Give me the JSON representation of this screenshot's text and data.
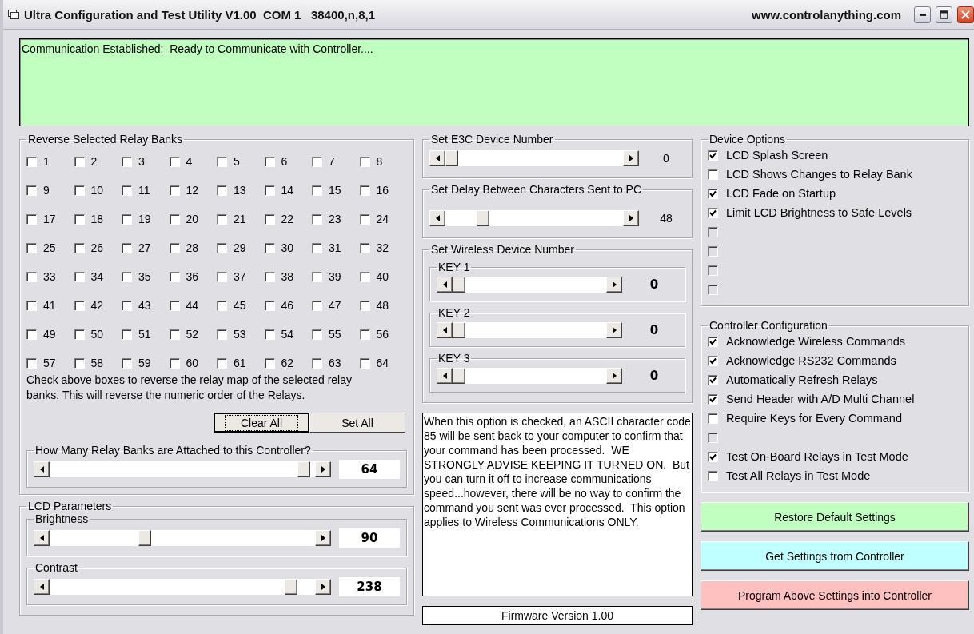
{
  "window": {
    "title": "Ultra Configuration and Test Utility V1.00  COM 1   38400,n,8,1",
    "website": "www.controlanything.com"
  },
  "status_message": "Communication Established:  Ready to Communicate with Controller....",
  "relay_banks": {
    "title": "Reverse Selected Relay Banks",
    "checkboxes": [
      {
        "label": "1",
        "checked": false
      },
      {
        "label": "2",
        "checked": false
      },
      {
        "label": "3",
        "checked": false
      },
      {
        "label": "4",
        "checked": false
      },
      {
        "label": "5",
        "checked": false
      },
      {
        "label": "6",
        "checked": false
      },
      {
        "label": "7",
        "checked": false
      },
      {
        "label": "8",
        "checked": false
      },
      {
        "label": "9",
        "checked": false
      },
      {
        "label": "10",
        "checked": false
      },
      {
        "label": "11",
        "checked": false
      },
      {
        "label": "12",
        "checked": false
      },
      {
        "label": "13",
        "checked": false
      },
      {
        "label": "14",
        "checked": false
      },
      {
        "label": "15",
        "checked": false
      },
      {
        "label": "16",
        "checked": false
      },
      {
        "label": "17",
        "checked": false
      },
      {
        "label": "18",
        "checked": false
      },
      {
        "label": "19",
        "checked": false
      },
      {
        "label": "20",
        "checked": false
      },
      {
        "label": "21",
        "checked": false
      },
      {
        "label": "22",
        "checked": false
      },
      {
        "label": "23",
        "checked": false
      },
      {
        "label": "24",
        "checked": false
      },
      {
        "label": "25",
        "checked": false
      },
      {
        "label": "26",
        "checked": false
      },
      {
        "label": "27",
        "checked": false
      },
      {
        "label": "28",
        "checked": false
      },
      {
        "label": "29",
        "checked": false
      },
      {
        "label": "30",
        "checked": false
      },
      {
        "label": "31",
        "checked": false
      },
      {
        "label": "32",
        "checked": false
      },
      {
        "label": "33",
        "checked": false
      },
      {
        "label": "34",
        "checked": false
      },
      {
        "label": "35",
        "checked": false
      },
      {
        "label": "36",
        "checked": false
      },
      {
        "label": "37",
        "checked": false
      },
      {
        "label": "38",
        "checked": false
      },
      {
        "label": "39",
        "checked": false
      },
      {
        "label": "40",
        "checked": false
      },
      {
        "label": "41",
        "checked": false
      },
      {
        "label": "42",
        "checked": false
      },
      {
        "label": "43",
        "checked": false
      },
      {
        "label": "44",
        "checked": false
      },
      {
        "label": "45",
        "checked": false
      },
      {
        "label": "46",
        "checked": false
      },
      {
        "label": "47",
        "checked": false
      },
      {
        "label": "48",
        "checked": false
      },
      {
        "label": "49",
        "checked": false
      },
      {
        "label": "50",
        "checked": false
      },
      {
        "label": "51",
        "checked": false
      },
      {
        "label": "52",
        "checked": false
      },
      {
        "label": "53",
        "checked": false
      },
      {
        "label": "54",
        "checked": false
      },
      {
        "label": "55",
        "checked": false
      },
      {
        "label": "56",
        "checked": false
      },
      {
        "label": "57",
        "checked": false
      },
      {
        "label": "58",
        "checked": false
      },
      {
        "label": "59",
        "checked": false
      },
      {
        "label": "60",
        "checked": false
      },
      {
        "label": "61",
        "checked": false
      },
      {
        "label": "62",
        "checked": false
      },
      {
        "label": "63",
        "checked": false
      },
      {
        "label": "64",
        "checked": false
      }
    ],
    "note": "Check above boxes to reverse the relay map of the selected relay banks.  This will reverse the numeric order of the Relays.",
    "buttons": [
      {
        "label": "Clear All",
        "focused": true
      },
      {
        "label": "Set All",
        "focused": false
      }
    ],
    "count_slider": {
      "title": "How Many Relay Banks are Attached to this Controller?",
      "reading": "64"
    }
  },
  "lcd_parameters": {
    "title": "LCD Parameters",
    "sliders": [
      {
        "title": "Brightness",
        "reading": "90"
      },
      {
        "title": "Contrast",
        "reading": "238"
      }
    ]
  },
  "e3c_device": {
    "title": "Set E3C Device Number",
    "reading": "0"
  },
  "char_delay": {
    "title": "Set Delay Between Characters Sent to PC",
    "reading": "48"
  },
  "wireless": {
    "title": "Set Wireless Device Number",
    "keys": [
      {
        "title": "KEY 1",
        "reading": "0"
      },
      {
        "title": "KEY 2",
        "reading": "0"
      },
      {
        "title": "KEY 3",
        "reading": "0"
      }
    ]
  },
  "help_text": "When this option is checked, an ASCII character code 85 will be sent back to your computer to confirm that your command has been processed.  WE STRONGLY ADVISE KEEPING IT TURNED ON.  But you can turn it off to increase communications speed...however, there will be no way to confirm the command you sent was ever processed.  This option applies to Wireless Communications ONLY.",
  "firmware": "Firmware Version 1.00",
  "device_options": {
    "title": "Device Options",
    "options": [
      {
        "label": "LCD Splash Screen",
        "checked": true,
        "disabled": false
      },
      {
        "label": "LCD Shows Changes to Relay Bank",
        "checked": false,
        "disabled": false
      },
      {
        "label": "LCD Fade on Startup",
        "checked": true,
        "disabled": false
      },
      {
        "label": "Limit LCD Brightness to Safe Levels",
        "checked": true,
        "disabled": false
      },
      {
        "checked": false,
        "disabled": true
      },
      {
        "checked": false,
        "disabled": true
      },
      {
        "checked": false,
        "disabled": true
      },
      {
        "checked": false,
        "disabled": true
      }
    ]
  },
  "controller_configuration": {
    "title": "Controller Configuration",
    "options": [
      {
        "label": "Acknowledge Wireless Commands",
        "checked": true,
        "disabled": false
      },
      {
        "label": "Acknowledge RS232 Commands",
        "checked": true,
        "disabled": false
      },
      {
        "label": "Automatically Refresh Relays",
        "checked": true,
        "disabled": false
      },
      {
        "label": "Send Header with A/D Multi Channel",
        "checked": true,
        "disabled": false
      },
      {
        "label": "Require Keys for Every Command",
        "checked": false,
        "disabled": false
      },
      {
        "checked": false,
        "disabled": true
      },
      {
        "label": "Test On-Board Relays in Test Mode",
        "checked": true,
        "disabled": false
      },
      {
        "label": "Test All Relays in Test Mode",
        "checked": false,
        "disabled": false
      }
    ]
  },
  "actions": [
    {
      "label": "Restore Default Settings",
      "color": "#c0ffc0"
    },
    {
      "label": "Get Settings from Controller",
      "color": "#c0ffff"
    },
    {
      "label": "Program Above Settings into Controller",
      "color": "#ffc0c0"
    }
  ]
}
